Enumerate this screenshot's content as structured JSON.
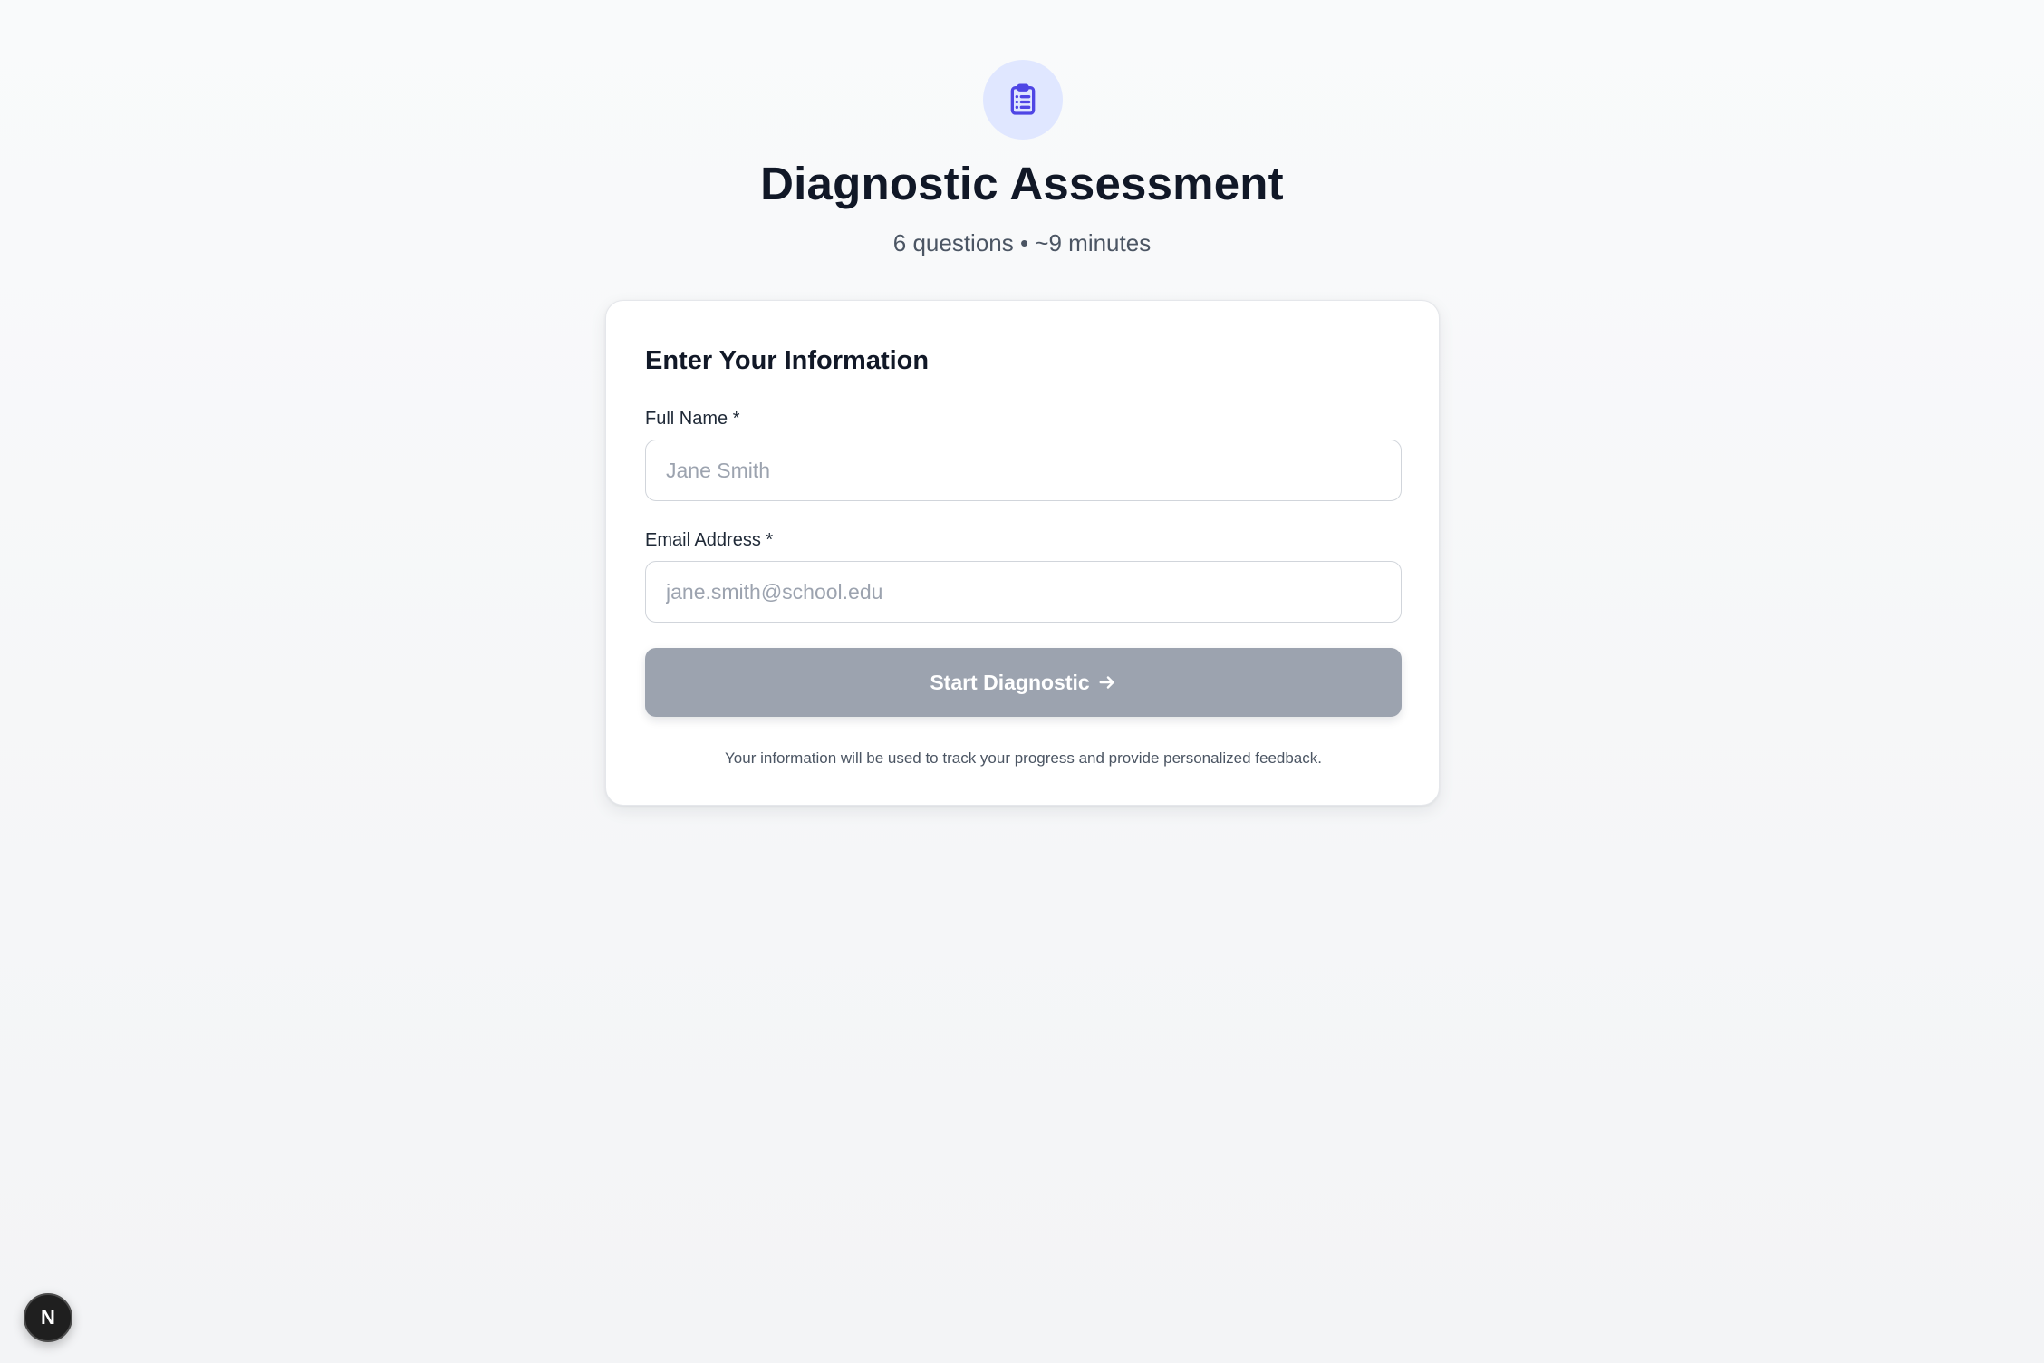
{
  "colors": {
    "background": "#f9fafb",
    "accent": "#4f46e5",
    "accent_soft": "#e0e7ff",
    "button_disabled": "#9ca3af",
    "title": "#111827",
    "muted": "#4b5563"
  },
  "header": {
    "icon": "clipboard-list-icon",
    "title": "Diagnostic Assessment",
    "subtitle": "6 questions • ~9 minutes"
  },
  "form": {
    "title": "Enter Your Information",
    "name_label": "Full Name *",
    "name_value": "",
    "name_placeholder": "Jane Smith",
    "email_label": "Email Address *",
    "email_value": "",
    "email_placeholder": "jane.smith@school.edu",
    "submit_label": "Start Diagnostic",
    "submit_icon": "arrow-right-icon",
    "footnote": "Your information will be used to track your progress and provide personalized feedback."
  },
  "dev_badge": {
    "label": "N",
    "icon": "nextjs-icon"
  }
}
